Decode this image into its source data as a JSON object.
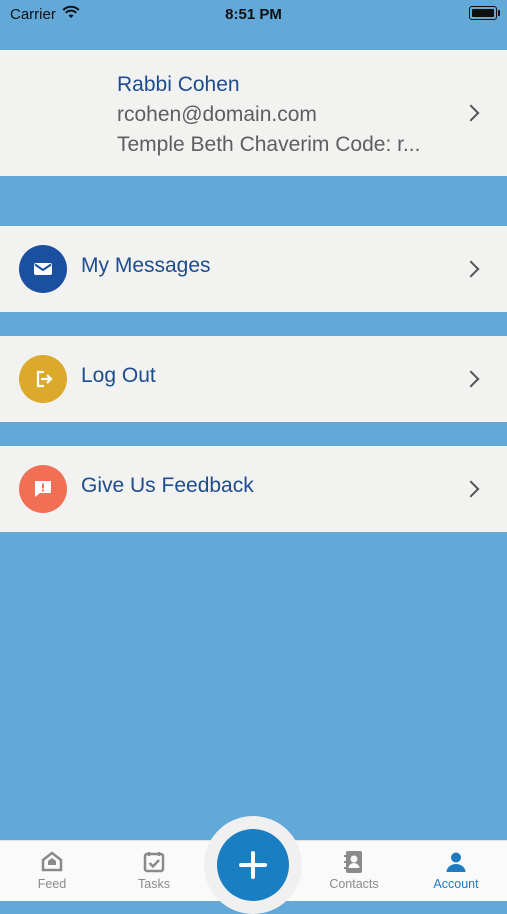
{
  "status_bar": {
    "carrier": "Carrier",
    "time": "8:51 PM"
  },
  "profile": {
    "name": "Rabbi Cohen",
    "email": "rcohen@domain.com",
    "temple": "Temple Beth Chaverim Code: r..."
  },
  "menu": {
    "messages": {
      "label": "My Messages",
      "icon": "mail-icon",
      "color": "#1b4fa0"
    },
    "logout": {
      "label": "Log Out",
      "icon": "logout-icon",
      "color": "#dcaa2b"
    },
    "feedback": {
      "label": "Give Us Feedback",
      "icon": "feedback-icon",
      "color": "#f06f55"
    }
  },
  "tab_bar": {
    "feed": "Feed",
    "tasks": "Tasks",
    "contacts": "Contacts",
    "account": "Account",
    "active": "Account",
    "add_icon": "plus-icon"
  },
  "colors": {
    "background": "#62a8d8",
    "accent": "#1a7ec2",
    "title_text": "#1d4c8f"
  }
}
